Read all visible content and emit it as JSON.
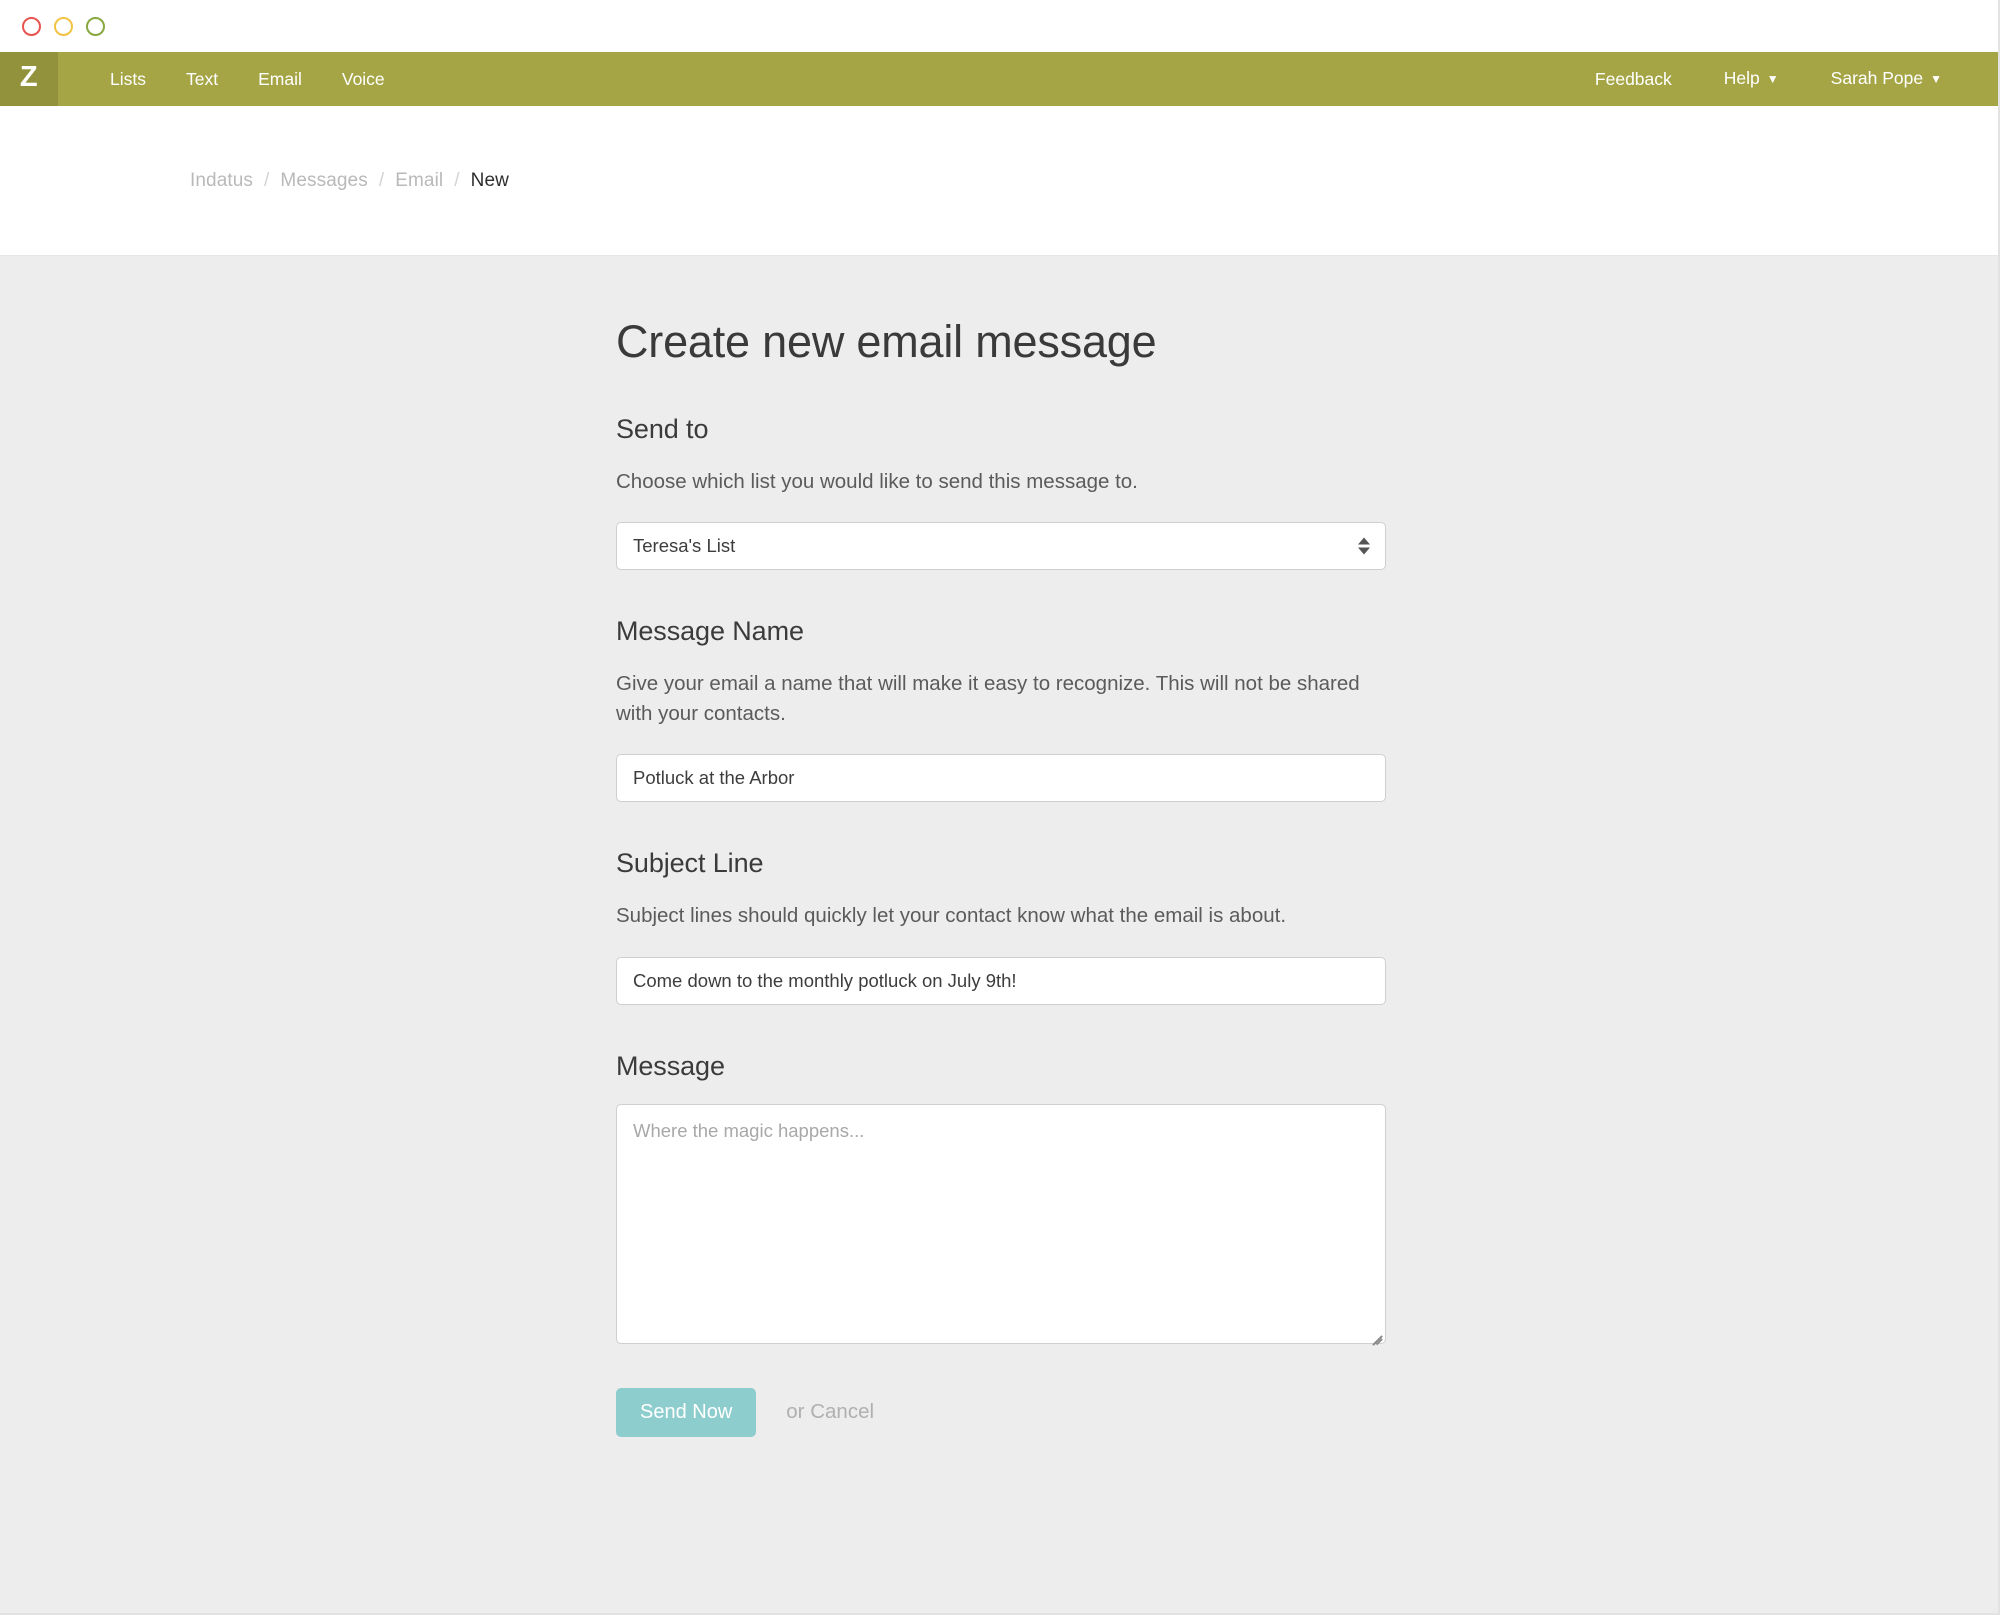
{
  "window": {
    "traffic_lights": [
      {
        "name": "close",
        "color": "#e8544d"
      },
      {
        "name": "minimize",
        "color": "#f2c242"
      },
      {
        "name": "zoom",
        "color": "#87a83e"
      }
    ]
  },
  "navbar": {
    "brand_letter": "Z",
    "brand_bg": "#92923c",
    "bar_bg": "#a5a546",
    "left_items": [
      {
        "label": "Lists"
      },
      {
        "label": "Text"
      },
      {
        "label": "Email"
      },
      {
        "label": "Voice"
      }
    ],
    "right_items": [
      {
        "label": "Feedback",
        "caret": ""
      },
      {
        "label": "Help",
        "caret": "▼"
      },
      {
        "label": "Sarah Pope",
        "caret": "▼"
      }
    ]
  },
  "breadcrumb": {
    "items": [
      {
        "label": "Indatus",
        "current": false
      },
      {
        "label": "Messages",
        "current": false
      },
      {
        "label": "Email",
        "current": false
      },
      {
        "label": "New",
        "current": true
      }
    ],
    "separator": "/"
  },
  "page": {
    "title": "Create new email message"
  },
  "form": {
    "send_to": {
      "label": "Send to",
      "help": "Choose which list you would like to send this message to.",
      "selected_value": "Teresa's List"
    },
    "message_name": {
      "label": "Message Name",
      "help": "Give your email a name that will make it easy to recognize. This will not be shared with your contacts.",
      "value": "Potluck at the Arbor",
      "placeholder": ""
    },
    "subject_line": {
      "label": "Subject Line",
      "help": "Subject lines should quickly let your contact know what the email is about.",
      "value": "Come down to the monthly potluck on July 9th!",
      "placeholder": ""
    },
    "message": {
      "label": "Message",
      "value": "",
      "placeholder": "Where the magic happens..."
    },
    "actions": {
      "submit_label": "Send Now",
      "submit_color": "#8ecdcd",
      "or_text": "or ",
      "cancel_label": "Cancel"
    }
  }
}
